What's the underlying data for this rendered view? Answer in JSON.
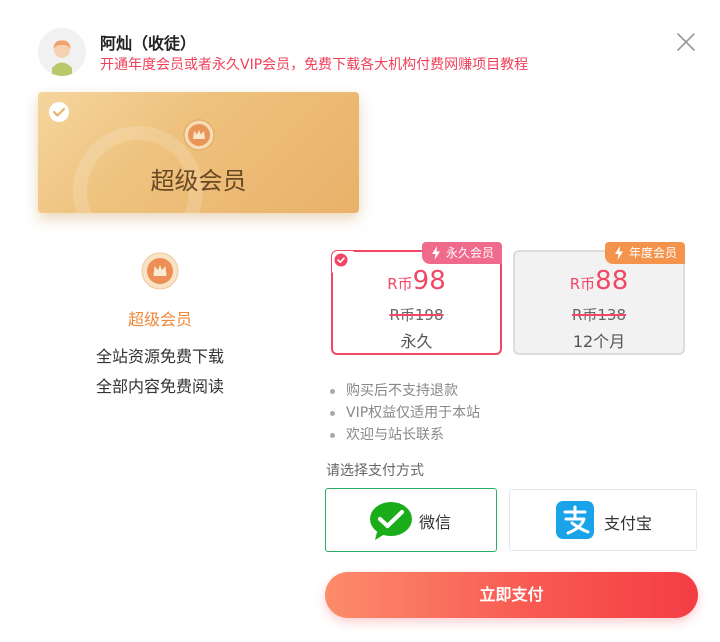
{
  "header": {
    "username": "阿灿（收徒）",
    "subtitle": "开通年度会员或者永久VIP会员，免费下载各大机构付费网赚项目教程",
    "avatar_icon": "user-avatar-icon",
    "close_icon": "close-icon"
  },
  "plan": {
    "name": "超级会员",
    "selected": true,
    "icons": [
      "checkmark-icon",
      "crown-icon"
    ]
  },
  "features": {
    "title": "超级会员",
    "items": [
      "全站资源免费下载",
      "全部内容免费阅读"
    ],
    "icon": "crown-medal-icon"
  },
  "price_options": [
    {
      "badge": "永久会员",
      "currency": "R币",
      "price": "98",
      "original": "R币198",
      "period": "永久",
      "selected": true,
      "badge_icon": "lightning-icon"
    },
    {
      "badge": "年度会员",
      "currency": "R币",
      "price": "88",
      "original": "R币138",
      "period": "12个月",
      "selected": false,
      "badge_icon": "lightning-icon"
    }
  ],
  "notes": [
    "购买后不支持退款",
    "VIP权益仅适用于本站",
    "欢迎与站长联系"
  ],
  "payment": {
    "label": "请选择支付方式",
    "methods": [
      {
        "name": "微信",
        "icon": "wechat-pay-icon",
        "selected": true
      },
      {
        "name": "支付宝",
        "icon": "alipay-icon",
        "selected": false
      }
    ],
    "pay_button": "立即支付"
  },
  "colors": {
    "accent_red": "#f04866",
    "gold": "#eec27d",
    "wechat_green": "#2aae67",
    "alipay_blue": "#1aa3e8",
    "pay_button": "#f85a52"
  }
}
